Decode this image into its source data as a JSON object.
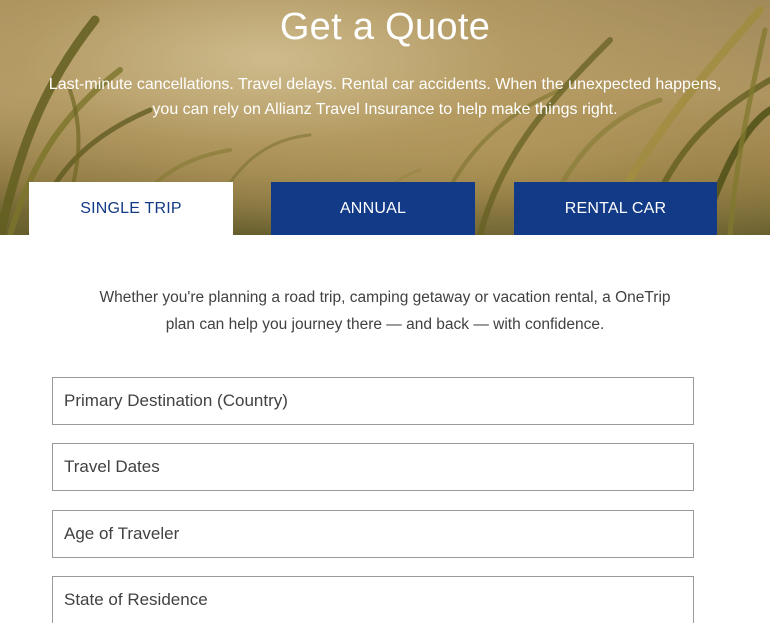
{
  "hero": {
    "title": "Get a Quote",
    "subtitle_line1": "Last-minute cancellations. Travel delays. Rental car accidents. When the unexpected happens,",
    "subtitle_line2": "you can rely on Allianz Travel Insurance to help make things right."
  },
  "tabs": [
    {
      "label": "SINGLE TRIP",
      "active": true
    },
    {
      "label": "ANNUAL",
      "active": false
    },
    {
      "label": "RENTAL CAR",
      "active": false
    }
  ],
  "intro": {
    "line1": "Whether you're planning a road trip, camping getaway or vacation rental, a OneTrip",
    "line2": "plan can help you journey there — and back — with confidence."
  },
  "form": {
    "fields": [
      {
        "placeholder": "Primary Destination (Country)",
        "value": ""
      },
      {
        "placeholder": "Travel Dates",
        "value": ""
      },
      {
        "placeholder": "Age of Traveler",
        "value": ""
      },
      {
        "placeholder": "State of Residence",
        "value": ""
      }
    ]
  },
  "colors": {
    "brand_blue": "#123a86",
    "text": "#414141",
    "field_border": "#9a9a9a",
    "white": "#ffffff"
  }
}
